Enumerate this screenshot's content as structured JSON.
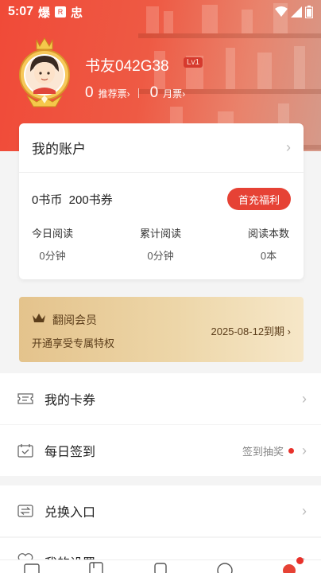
{
  "status_bar": {
    "time": "5:07",
    "icon_a": "爆",
    "icon_b": "R",
    "icon_c": "忠"
  },
  "profile": {
    "nickname": "书友042G38",
    "level": "Lv1",
    "recommend_count": "0",
    "recommend_label": "推荐票",
    "monthly_count": "0",
    "monthly_label": "月票"
  },
  "account": {
    "title": "我的账户",
    "balance": "0书币  200书券",
    "recharge_label": "首充福利",
    "stats": [
      {
        "label": "今日阅读",
        "value": "0分钟"
      },
      {
        "label": "累计阅读",
        "value": "0分钟"
      },
      {
        "label": "阅读本数",
        "value": "0本"
      }
    ]
  },
  "member": {
    "title": "翻阅会员",
    "subtitle": "开通享受专属特权",
    "expiry": "2025-08-12到期"
  },
  "menu": {
    "coupons": "我的卡券",
    "checkin": "每日签到",
    "checkin_extra": "签到抽奖",
    "exchange": "兑换入口",
    "settings": "我的设置"
  },
  "colors": {
    "brand": "#e64235",
    "gold": "#e4c38c"
  }
}
